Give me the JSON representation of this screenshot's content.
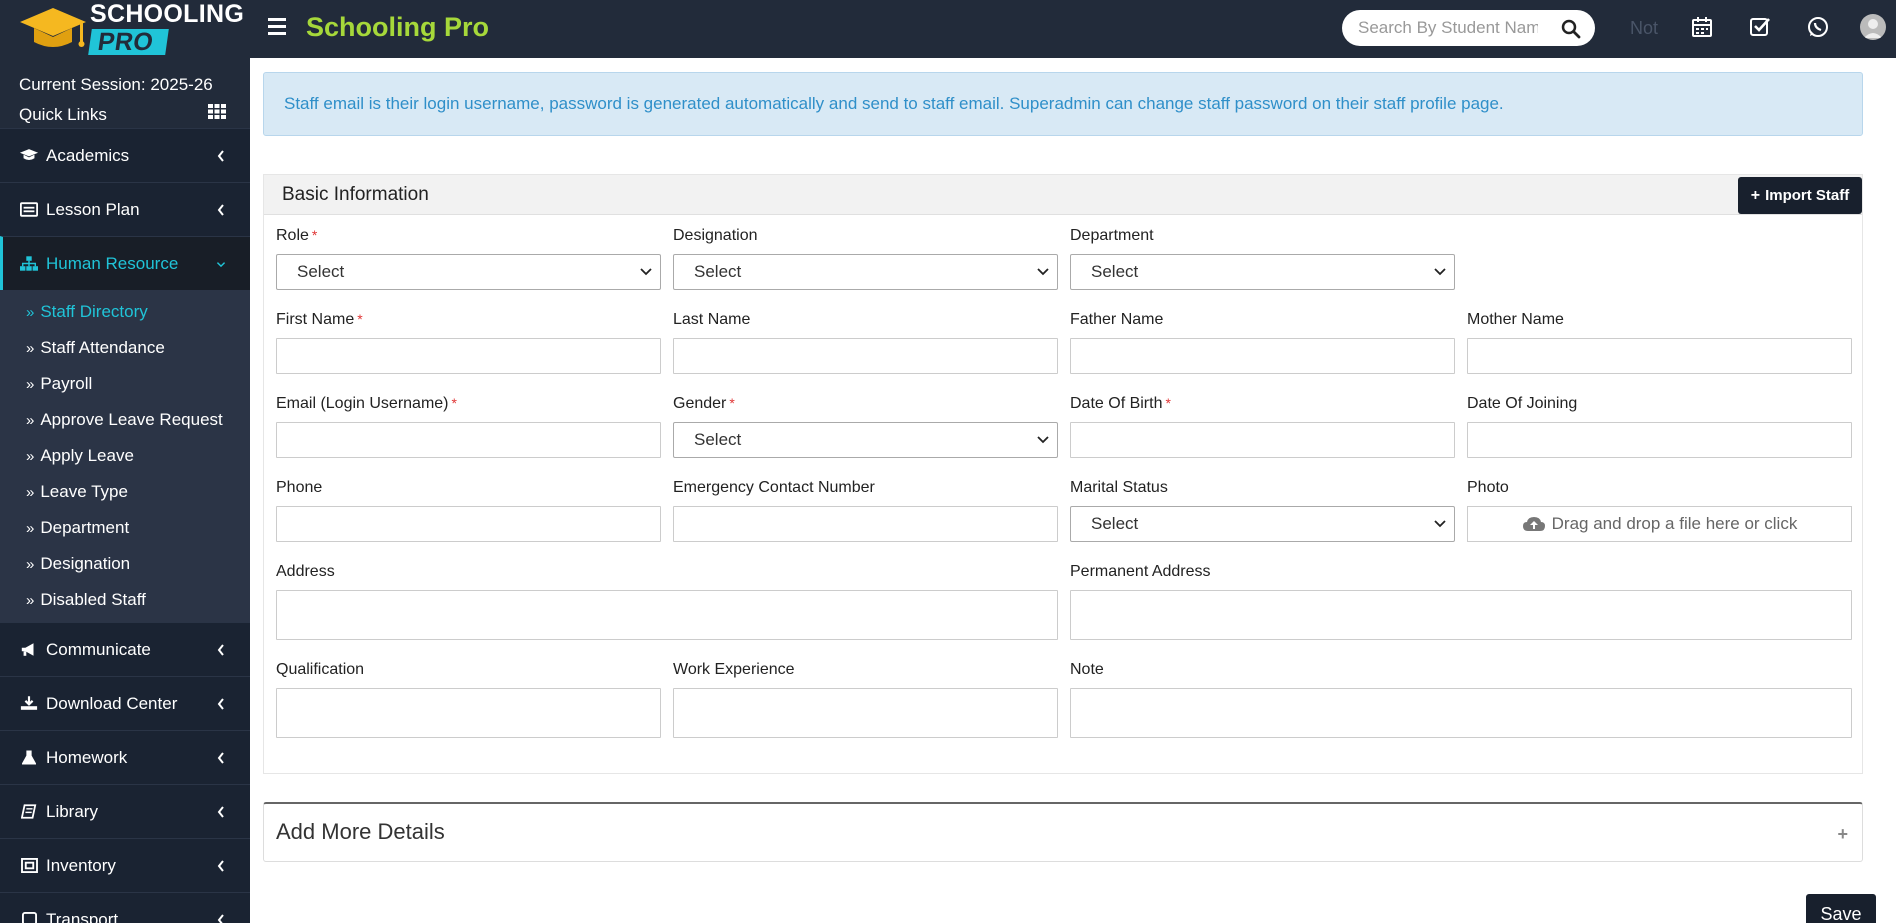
{
  "header": {
    "logo_text_top": "SCHOOLING",
    "logo_text_bottom": "PRO",
    "app_title": "Schooling Pro",
    "search_placeholder": "Search By Student Name",
    "notification_text": "Not",
    "icons": [
      "calendar-icon",
      "checklist-icon",
      "whatsapp-icon",
      "user-avatar"
    ]
  },
  "sidebar": {
    "session": "Current Session: 2025-26",
    "quick_links": "Quick Links",
    "menu": [
      {
        "label": "Academics",
        "icon": "graduation-cap-icon"
      },
      {
        "label": "Lesson Plan",
        "icon": "list-icon"
      },
      {
        "label": "Human Resource",
        "icon": "sitemap-icon",
        "active": true
      },
      {
        "label": "Communicate",
        "icon": "bullhorn-icon"
      },
      {
        "label": "Download Center",
        "icon": "download-icon"
      },
      {
        "label": "Homework",
        "icon": "flask-icon"
      },
      {
        "label": "Library",
        "icon": "book-icon"
      },
      {
        "label": "Inventory",
        "icon": "box-icon"
      },
      {
        "label": "Transport",
        "icon": "bus-icon"
      }
    ],
    "submenu": [
      "Staff Directory",
      "Staff Attendance",
      "Payroll",
      "Approve Leave Request",
      "Apply Leave",
      "Leave Type",
      "Department",
      "Designation",
      "Disabled Staff"
    ]
  },
  "main": {
    "callout": "Staff email is their login username, password is generated automatically and send to staff email. Superadmin can change staff password on their staff profile page.",
    "basic_title": "Basic Information",
    "import_label": "Import Staff",
    "select_placeholder": "Select",
    "fields": {
      "role": "Role",
      "designation": "Designation",
      "department": "Department",
      "first_name": "First Name",
      "last_name": "Last Name",
      "father_name": "Father Name",
      "mother_name": "Mother Name",
      "email": "Email (Login Username)",
      "gender": "Gender",
      "dob": "Date Of Birth",
      "doj": "Date Of Joining",
      "phone": "Phone",
      "emergency": "Emergency Contact Number",
      "marital": "Marital Status",
      "photo": "Photo",
      "address": "Address",
      "permanent_address": "Permanent Address",
      "qualification": "Qualification",
      "work_experience": "Work Experience",
      "note": "Note"
    },
    "photo_drop": "Drag and drop a file here or click",
    "more_details": "Add More Details",
    "more_plus": "+",
    "save_label": "Save"
  },
  "colors": {
    "topbar": "#222b3a",
    "accent": "#20c4d8",
    "title_green": "#a6d83a",
    "required": "#e03535"
  }
}
